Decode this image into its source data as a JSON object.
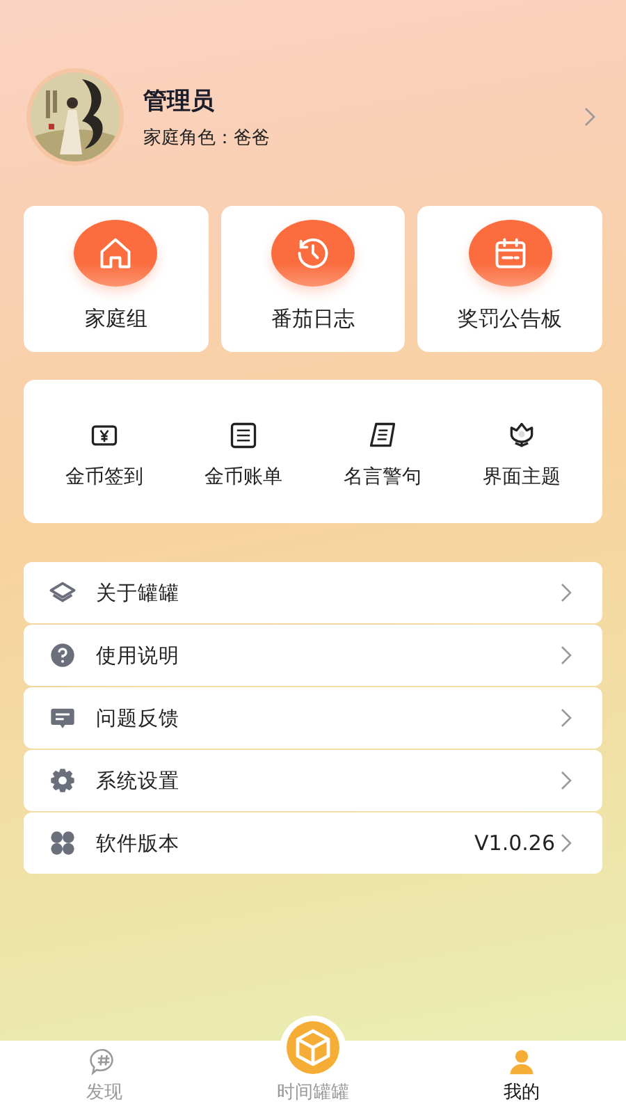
{
  "profile": {
    "name": "管理员",
    "role": "家庭角色：爸爸"
  },
  "feature_cards": [
    {
      "label": "家庭组",
      "kind": "house"
    },
    {
      "label": "番茄日志",
      "kind": "clock"
    },
    {
      "label": "奖罚公告板",
      "kind": "calendar"
    }
  ],
  "tools": [
    {
      "label": "金币签到",
      "kind": "yen"
    },
    {
      "label": "金币账单",
      "kind": "bill"
    },
    {
      "label": "名言警句",
      "kind": "scroll"
    },
    {
      "label": "界面主题",
      "kind": "flower"
    }
  ],
  "menu": [
    {
      "label": "关于罐罐",
      "kind": "layers"
    },
    {
      "label": "使用说明",
      "kind": "help"
    },
    {
      "label": "问题反馈",
      "kind": "message"
    },
    {
      "label": "系统设置",
      "kind": "gear"
    },
    {
      "label": "软件版本",
      "kind": "grid",
      "value": "V1.0.26"
    }
  ],
  "tab_bar": [
    {
      "label": "发现",
      "kind": "hash",
      "selected": false
    },
    {
      "label": "时间罐罐",
      "kind": "box",
      "selected": false
    },
    {
      "label": "我的",
      "kind": "person",
      "selected": true
    }
  ]
}
